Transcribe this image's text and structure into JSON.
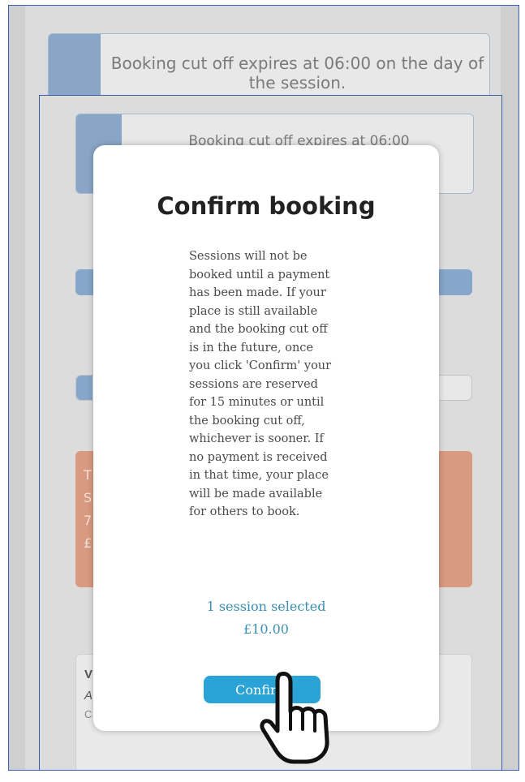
{
  "background": {
    "notice_text": "Booking cut off expires at 06:00 on the day of the session.",
    "notice_text_inner": "Booking cut off expires at 06:00",
    "peek_orange": [
      "T",
      "S",
      "7",
      "£"
    ],
    "peek_white": [
      "V",
      "A",
      "C"
    ]
  },
  "modal": {
    "title": "Confirm booking",
    "body_lines": [
      "Sessions will not be",
      "booked until a payment",
      "has been made. If your",
      "place is still available",
      "and the booking cut off",
      "is in the future, once",
      "you click 'Confirm' your",
      "sessions are reserved",
      "for 15 minutes or until",
      "the booking cut off,",
      "whichever is sooner. If",
      "no payment is received",
      "in that time, your place",
      "will be made available",
      "for others to book."
    ],
    "sessions_selected": "1 session selected",
    "total_price": "£10.00",
    "confirm_label": "Confirm"
  },
  "colors": {
    "accent": "#2aa3d6",
    "summary_text": "#3b8fb3",
    "stripe_blue": "#8aa6c6",
    "warning_orange": "#d89a80"
  },
  "icons": {
    "cursor": "hand-pointer-icon"
  }
}
